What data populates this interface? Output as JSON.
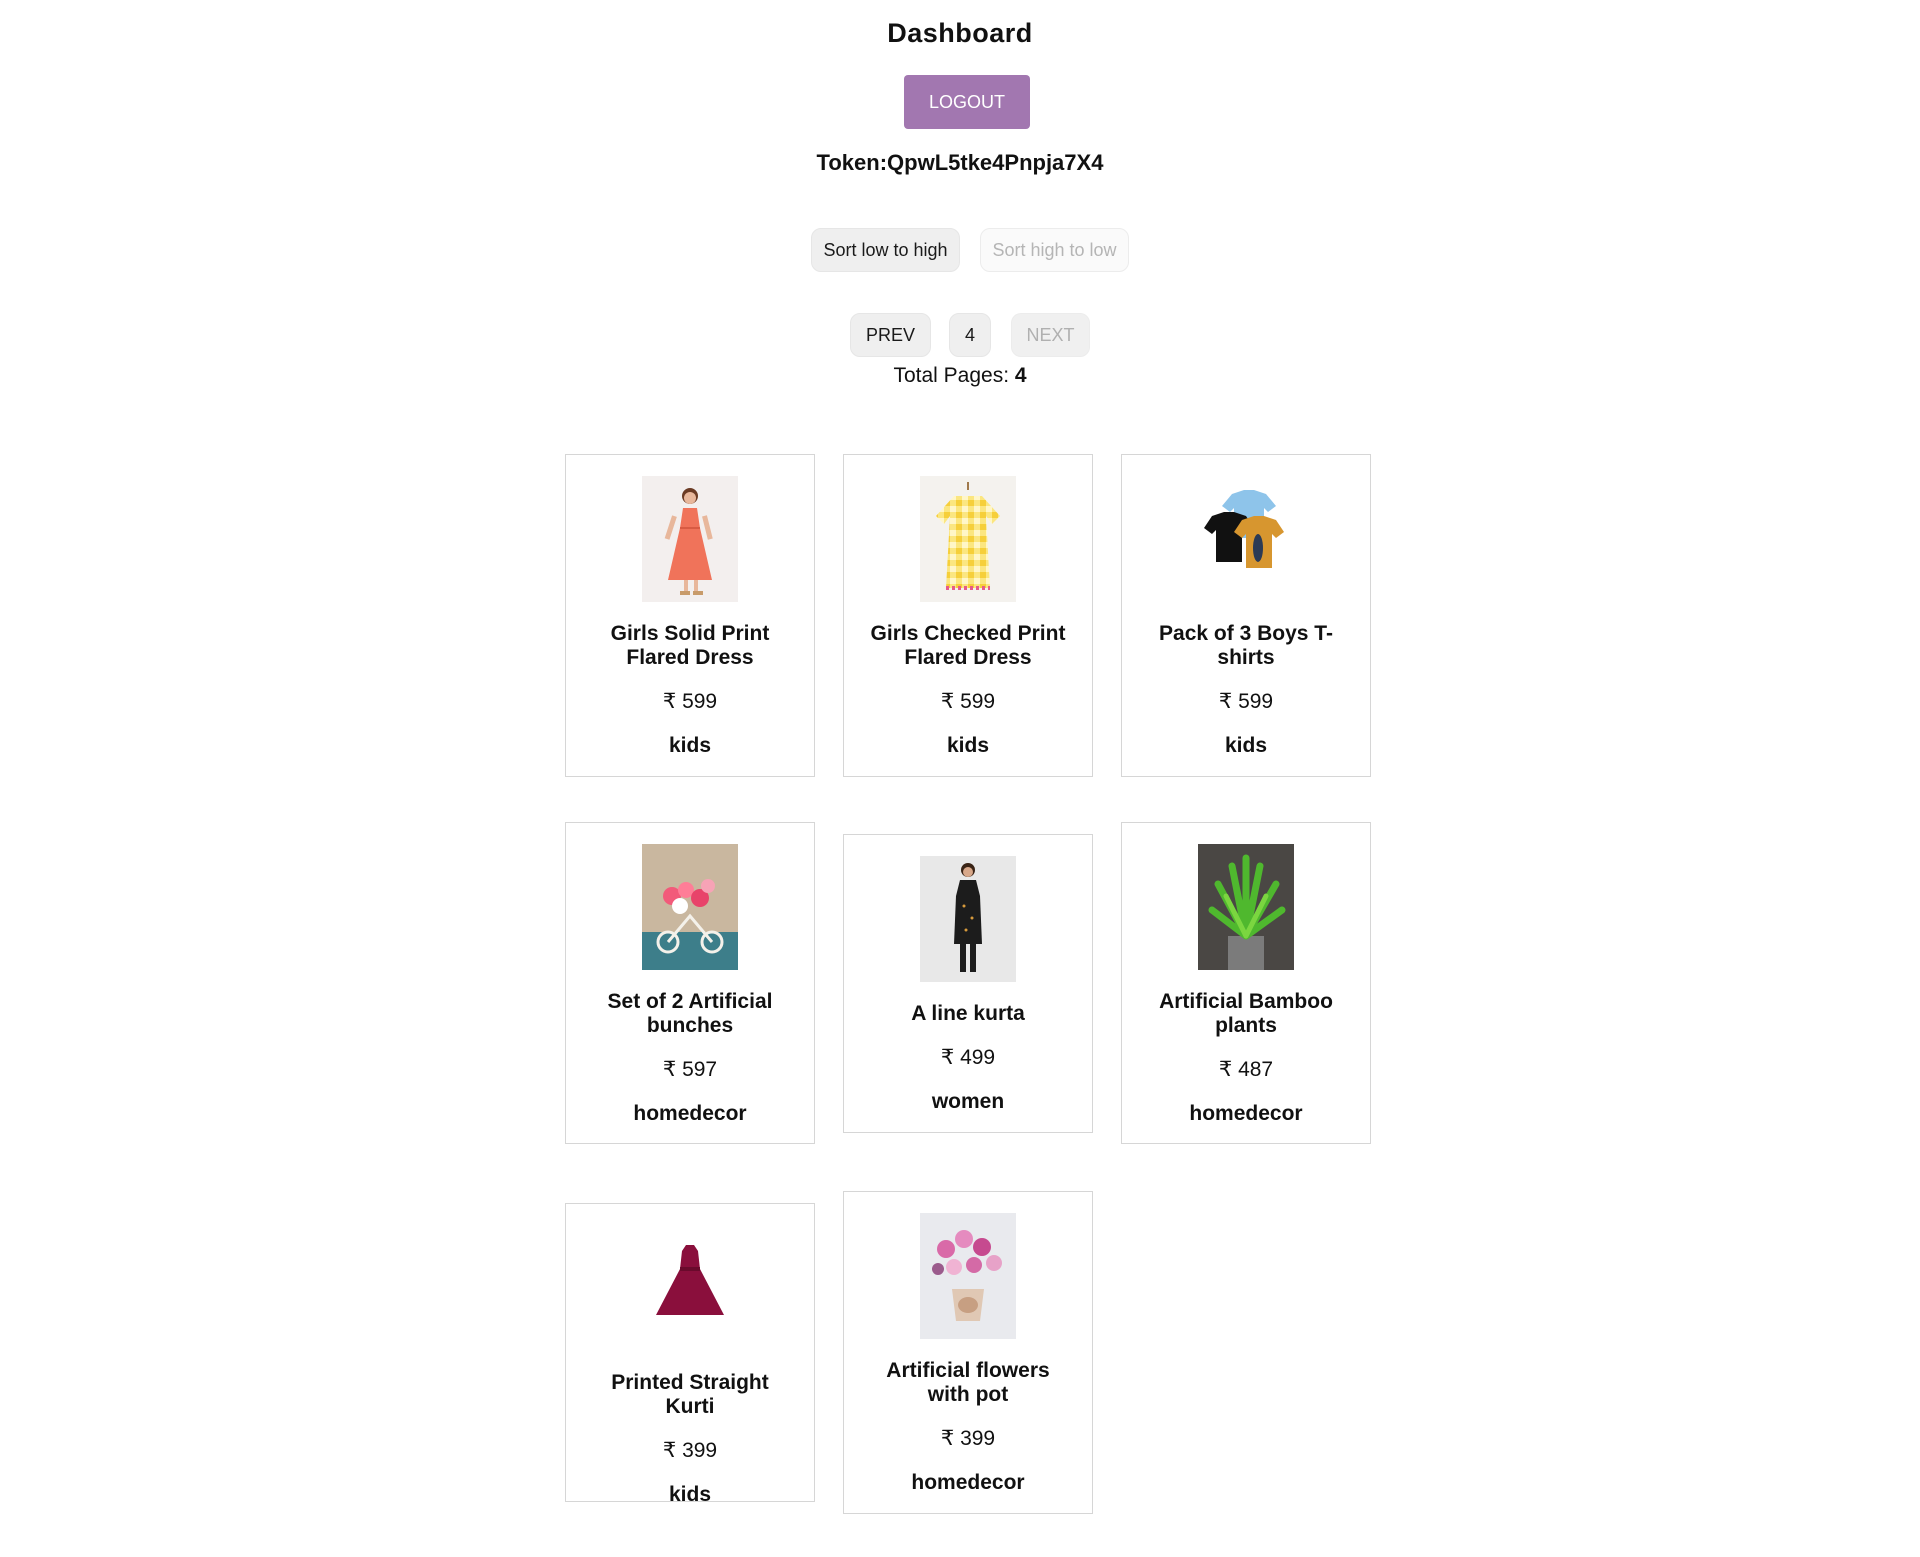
{
  "header": {
    "title": "Dashboard",
    "logout_label": "LOGOUT",
    "token_label": "Token:QpwL5tke4Pnpja7X4"
  },
  "sort": {
    "low_to_high": "Sort low to high",
    "high_to_low": "Sort high to low"
  },
  "pagination": {
    "prev": "PREV",
    "current": "4",
    "next": "NEXT",
    "total_label": "Total Pages: ",
    "total_value": "4"
  },
  "currency": "₹",
  "products": [
    {
      "name": "Girls Solid Print Flared Dress",
      "price": "₹ 599",
      "category": "kids",
      "image_icon": "girl-dress-photo"
    },
    {
      "name": "Girls Checked Print Flared Dress",
      "price": "₹ 599",
      "category": "kids",
      "image_icon": "checked-dress-photo"
    },
    {
      "name": "Pack of 3 Boys T-shirts",
      "price": "₹ 599",
      "category": "kids",
      "image_icon": "tshirts-photo"
    },
    {
      "name": "Set of 2 Artificial bunches",
      "price": "₹ 597",
      "category": "homedecor",
      "image_icon": "flower-bunches-photo"
    },
    {
      "name": "A line kurta",
      "price": "₹ 499",
      "category": "women",
      "image_icon": "kurta-photo"
    },
    {
      "name": "Artificial Bamboo plants",
      "price": "₹ 487",
      "category": "homedecor",
      "image_icon": "bamboo-plant-photo"
    },
    {
      "name": "Printed Straight Kurti",
      "price": "₹ 399",
      "category": "kids",
      "image_icon": "maroon-dress-photo"
    },
    {
      "name": "Artificial flowers with pot",
      "price": "₹ 399",
      "category": "homedecor",
      "image_icon": "flowers-pot-photo"
    }
  ]
}
